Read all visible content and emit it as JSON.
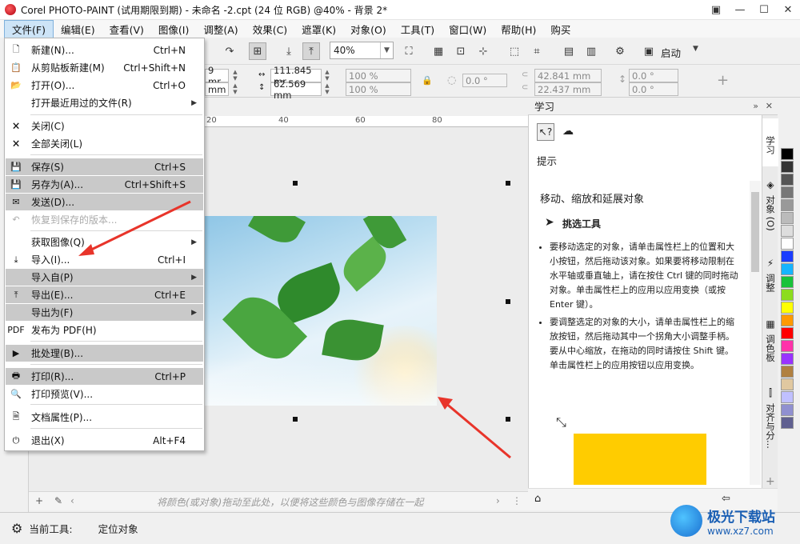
{
  "title": "Corel PHOTO-PAINT (试用期限到期) - 未命名 -2.cpt (24 位 RGB) @40% - 背景 2*",
  "window_controls": [
    "▣",
    "—",
    "☐",
    "✕"
  ],
  "menubar": [
    "文件(F)",
    "编辑(E)",
    "查看(V)",
    "图像(I)",
    "调整(A)",
    "效果(C)",
    "遮罩(K)",
    "对象(O)",
    "工具(T)",
    "窗口(W)",
    "帮助(H)",
    "购买"
  ],
  "toolbar": {
    "zoom_value": "40%",
    "launch_label": "启动"
  },
  "property_bar": {
    "x_pos": "9 mr",
    "y_pos": "mm",
    "width": "111.845 mr",
    "height": "62.569 mm",
    "scale_w": "100 %",
    "scale_h": "100 %",
    "rotate": "0.0 °",
    "skew_x": "42.841 mm",
    "skew_y": "22.437 mm",
    "angle_1": "0.0 °",
    "angle_2": "0.0 °"
  },
  "ruler_ticks": [
    "20",
    "40",
    "60",
    "80"
  ],
  "file_menu": [
    {
      "label": "新建(N)...",
      "shortcut": "Ctrl+N",
      "icon": "new-doc-icon",
      "glyph": "🗋",
      "hl": false,
      "disabled": false,
      "sub": false
    },
    {
      "label": "从剪贴板新建(M)",
      "shortcut": "Ctrl+Shift+N",
      "icon": "clipboard-icon",
      "glyph": "📋",
      "hl": false,
      "disabled": false,
      "sub": false
    },
    {
      "label": "打开(O)...",
      "shortcut": "Ctrl+O",
      "icon": "folder-icon",
      "glyph": "📂",
      "hl": false,
      "disabled": false,
      "sub": false
    },
    {
      "label": "打开最近用过的文件(R)",
      "shortcut": "",
      "icon": "",
      "glyph": "",
      "hl": false,
      "disabled": false,
      "sub": true
    },
    {
      "label": "关闭(C)",
      "shortcut": "",
      "icon": "close-doc-icon",
      "glyph": "🗙",
      "hl": false,
      "disabled": false,
      "sub": false
    },
    {
      "label": "全部关闭(L)",
      "shortcut": "",
      "icon": "close-all-icon",
      "glyph": "🗙",
      "hl": false,
      "disabled": false,
      "sub": false
    },
    {
      "label": "保存(S)",
      "shortcut": "Ctrl+S",
      "icon": "save-icon",
      "glyph": "💾",
      "hl": true,
      "disabled": false,
      "sub": false
    },
    {
      "label": "另存为(A)...",
      "shortcut": "Ctrl+Shift+S",
      "icon": "save-as-icon",
      "glyph": "💾",
      "hl": true,
      "disabled": false,
      "sub": false
    },
    {
      "label": "发送(D)...",
      "shortcut": "",
      "icon": "mail-icon",
      "glyph": "✉",
      "hl": true,
      "disabled": false,
      "sub": false
    },
    {
      "label": "恢复到保存的版本...",
      "shortcut": "",
      "icon": "revert-icon",
      "glyph": "↶",
      "hl": false,
      "disabled": true,
      "sub": false
    },
    {
      "label": "获取图像(Q)",
      "shortcut": "",
      "icon": "",
      "glyph": "",
      "hl": false,
      "disabled": false,
      "sub": true
    },
    {
      "label": "导入(I)...",
      "shortcut": "Ctrl+I",
      "icon": "import-icon",
      "glyph": "⤓",
      "hl": false,
      "disabled": false,
      "sub": false
    },
    {
      "label": "导入自(P)",
      "shortcut": "",
      "icon": "",
      "glyph": "",
      "hl": true,
      "disabled": false,
      "sub": true
    },
    {
      "label": "导出(E)...",
      "shortcut": "Ctrl+E",
      "icon": "export-icon",
      "glyph": "⤒",
      "hl": true,
      "disabled": false,
      "sub": false
    },
    {
      "label": "导出为(F)",
      "shortcut": "",
      "icon": "",
      "glyph": "",
      "hl": true,
      "disabled": false,
      "sub": true
    },
    {
      "label": "发布为 PDF(H)",
      "shortcut": "",
      "icon": "pdf-icon",
      "glyph": "PDF",
      "hl": false,
      "disabled": false,
      "sub": false
    },
    {
      "label": "批处理(B)...",
      "shortcut": "",
      "icon": "batch-icon",
      "glyph": "▶",
      "hl": true,
      "disabled": false,
      "sub": false
    },
    {
      "label": "打印(R)...",
      "shortcut": "Ctrl+P",
      "icon": "print-icon",
      "glyph": "🖶",
      "hl": true,
      "disabled": false,
      "sub": false
    },
    {
      "label": "打印预览(V)...",
      "shortcut": "",
      "icon": "print-preview-icon",
      "glyph": "🔍",
      "hl": false,
      "disabled": false,
      "sub": false
    },
    {
      "label": "文档属性(P)...",
      "shortcut": "",
      "icon": "doc-props-icon",
      "glyph": "🗎",
      "hl": false,
      "disabled": false,
      "sub": false
    },
    {
      "label": "退出(X)",
      "shortcut": "Alt+F4",
      "icon": "power-icon",
      "glyph": "⏻",
      "hl": false,
      "disabled": false,
      "sub": false
    }
  ],
  "docker": {
    "title": "学习",
    "hint": "提示",
    "heading": "移动、缩放和延展对象",
    "tool_name": "挑选工具",
    "bullet1": "要移动选定的对象，请单击属性栏上的位置和大小按钮，然后拖动该对象。如果要将移动限制在水平轴或垂直轴上，请在按住 Ctrl 键的同时拖动对象。单击属性栏上的应用以应用变换（或按 Enter 键）。",
    "bullet2": "要调整选定的对象的大小，请单击属性栏上的缩放按钮，然后拖动其中一个拐角大小调整手柄。要从中心缩放，在拖动的同时请按住 Shift 键。单击属性栏上的应用按钮以应用变换。"
  },
  "vertical_tabs": [
    "学习",
    "对象 (O)",
    "调整",
    "调色板",
    "对齐与分..."
  ],
  "palette_colors": [
    "#000000",
    "#333333",
    "#555555",
    "#777777",
    "#999999",
    "#bbbbbb",
    "#dddddd",
    "#ffffff",
    "#1a3cff",
    "#16b4ff",
    "#18c23a",
    "#8cdc1e",
    "#ffff00",
    "#ff9900",
    "#ff0000",
    "#ff33aa",
    "#9933ff",
    "#b08040",
    "#e0c8a0",
    "#c0c0ff",
    "#9090d0",
    "#606090"
  ],
  "canvas_hint": "将颜色(或对象)拖动至此处，以便将这些颜色与图像存储在一起",
  "status": {
    "label": "当前工具:",
    "value": "定位对象"
  },
  "watermark": {
    "title": "极光下载站",
    "url": "www.xz7.com"
  }
}
